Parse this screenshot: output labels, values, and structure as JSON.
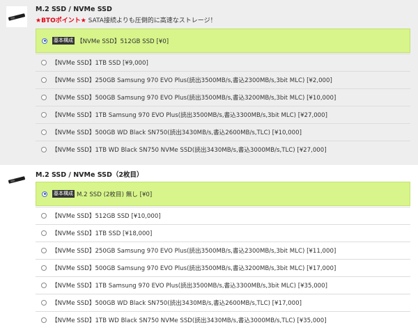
{
  "section1": {
    "title": "M.2 SSD / NVMe SSD",
    "promo_star_left": "★BTOポイント★",
    "promo_text": " SATA接続よりも圧倒的に高速なストレージ！",
    "selected": {
      "badge": "基本構成",
      "label": "【NVMe SSD】512GB SSD [¥0]"
    },
    "options": [
      "【NVMe SSD】1TB SSD [¥9,000]",
      "【NVMe SSD】250GB Samsung 970 EVO Plus(読出3500MB/s,書込2300MB/s,3bit MLC) [¥2,000]",
      "【NVMe SSD】500GB Samsung 970 EVO Plus(読出3500MB/s,書込3200MB/s,3bit MLC) [¥10,000]",
      "【NVMe SSD】1TB Samsung 970 EVO Plus(読出3500MB/s,書込3300MB/s,3bit MLC) [¥27,000]",
      "【NVMe SSD】500GB WD Black SN750(読出3430MB/s,書込2600MB/s,TLC) [¥10,000]",
      "【NVMe SSD】1TB WD Black SN750 NVMe SSD(読出3430MB/s,書込3000MB/s,TLC) [¥27,000]"
    ]
  },
  "section2": {
    "title": "M.2 SSD / NVMe SSD（2枚目）",
    "selected": {
      "badge": "基本構成",
      "label": "M.2 SSD (2枚目) 無し [¥0]"
    },
    "options": [
      "【NVMe SSD】512GB SSD [¥10,000]",
      "【NVMe SSD】1TB SSD [¥18,000]",
      "【NVMe SSD】250GB Samsung 970 EVO Plus(読出3500MB/s,書込2300MB/s,3bit MLC) [¥11,000]",
      "【NVMe SSD】500GB Samsung 970 EVO Plus(読出3500MB/s,書込3200MB/s,3bit MLC) [¥17,000]",
      "【NVMe SSD】1TB Samsung 970 EVO Plus(読出3500MB/s,書込3300MB/s,3bit MLC) [¥35,000]",
      "【NVMe SSD】500GB WD Black SN750(読出3430MB/s,書込2600MB/s,TLC) [¥17,000]",
      "【NVMe SSD】1TB WD Black SN750 NVMe SSD(読出3430MB/s,書込3000MB/s,TLC) [¥35,000]"
    ]
  }
}
